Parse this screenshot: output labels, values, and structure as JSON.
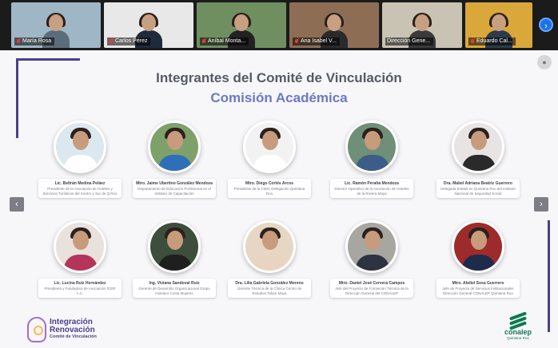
{
  "participants": [
    {
      "name": "María Rosa",
      "bg": "#9fb6c6",
      "shirt": "#5b6d7a"
    },
    {
      "name": "Carlos Pérez",
      "bg": "#e8e8e8",
      "shirt": "#1f2a3a"
    },
    {
      "name": "Aníbal Monta...",
      "bg": "#6f8f60",
      "shirt": "#222222"
    },
    {
      "name": "Ana Isabel V...",
      "bg": "#8d6e55",
      "shirt": "#2a2a2a"
    },
    {
      "name": "Dirección Gene...",
      "bg": "#c9c3b3",
      "shirt": "#3a3a3a"
    },
    {
      "name": "Eduardo Cal...",
      "bg": "#d9a73a",
      "shirt": "#2d3a4a"
    }
  ],
  "slide": {
    "title": "Integrantes del Comité de Vinculación",
    "subtitle": "Comisión Académica",
    "members_row1": [
      {
        "name": "Lic. Beltrán Medina Peláez",
        "role": "Presidente de la Asociación de Hoteles y Servicios Turísticos del Centro y Sur de Q.Roo",
        "bg": "#dbe8ef",
        "shirt": "#ffffff"
      },
      {
        "name": "Mtro. Jaime Ubertino González Mendoza",
        "role": "Departamento de Educación Profesional en el Instituto de Capacitación",
        "bg": "#7ea06b",
        "shirt": "#2f6fb7"
      },
      {
        "name": "Mtro. Diego Cortés Arcos",
        "role": "Presidente de la CMIC Delegación Quintana Roo",
        "bg": "#f2f2f2",
        "shirt": "#ffffff"
      },
      {
        "name": "Lic. Ramón Peralta Mendoza",
        "role": "Director Operativo de la Asociación de Hoteles de la Riviera Maya",
        "bg": "#6f8f78",
        "shirt": "#3c5d87"
      },
      {
        "name": "Dra. Mabel Adriana Beatriz Guerrero",
        "role": "Delegada Estatal en Quintana Roo del Instituto Nacional de Seguridad Social",
        "bg": "#e9e4e4",
        "shirt": "#2a2a2a"
      }
    ],
    "members_row2": [
      {
        "name": "Lic. Lucina Ruiz Hernández",
        "role": "Presidenta y Fundadora de Asociación ICER A.C.",
        "bg": "#e8e1dc",
        "shirt": "#b5345a"
      },
      {
        "name": "Ing. Viviana Sandoval Ruiz",
        "role": "Gerente de Desarrollo Organizacional Grupo Hotelero Costa Mujeres",
        "bg": "#3d4e3c",
        "shirt": "#1f1f1f"
      },
      {
        "name": "Dra. Lilia Gabriela González Moreno",
        "role": "Gerente Técnica de la Clínica Centro de Estudios Tulum Maya",
        "bg": "#e6d7c4",
        "shirt": "#ead3c0"
      },
      {
        "name": "Mtro. Daniel José Cervera Campos",
        "role": "Jefe del Proyecto de Formación Técnica de la Dirección General del CONALEP",
        "bg": "#a7a6a0",
        "shirt": "#2d3340"
      },
      {
        "name": "Mtro. Abdiel Sosa Guerrero",
        "role": "Jefe de Proyecto de Servicios Institucionales Dirección General CONALEP Quintana Roo",
        "bg": "#9e2b2b",
        "shirt": "#1d2b4d"
      }
    ],
    "logo_left": {
      "line1": "Integración",
      "line2": "Renovación",
      "line3": "Comité de Vinculación"
    },
    "logo_right": {
      "name": "conalep",
      "sub": "Quintana Roo"
    }
  },
  "controls": {
    "next_participants": "›",
    "prev_slide": "‹",
    "next_slide": "›"
  }
}
